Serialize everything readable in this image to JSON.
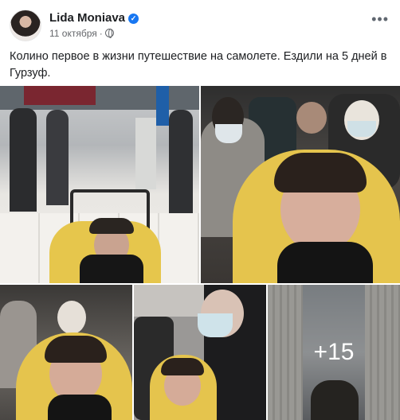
{
  "post": {
    "author": "Lida Moniava",
    "date": "11 октября",
    "dot": "·",
    "text": "Колино первое в жизни путешествие на самолете. Ездили на 5 дней в Гурзуф."
  },
  "gallery": {
    "more_count": "+15",
    "photos": [
      {
        "desc": "Airport terminal"
      },
      {
        "desc": "Airplane cabin"
      },
      {
        "desc": "Airplane cabin"
      },
      {
        "desc": "Airplane cabin"
      },
      {
        "desc": "Window view"
      }
    ]
  },
  "icons": [
    "verified-badge-icon",
    "globe-icon",
    "more-options-icon"
  ],
  "colors": {
    "accent": "#1877f2",
    "text": "#1c1e21",
    "secondary": "#65676b"
  }
}
